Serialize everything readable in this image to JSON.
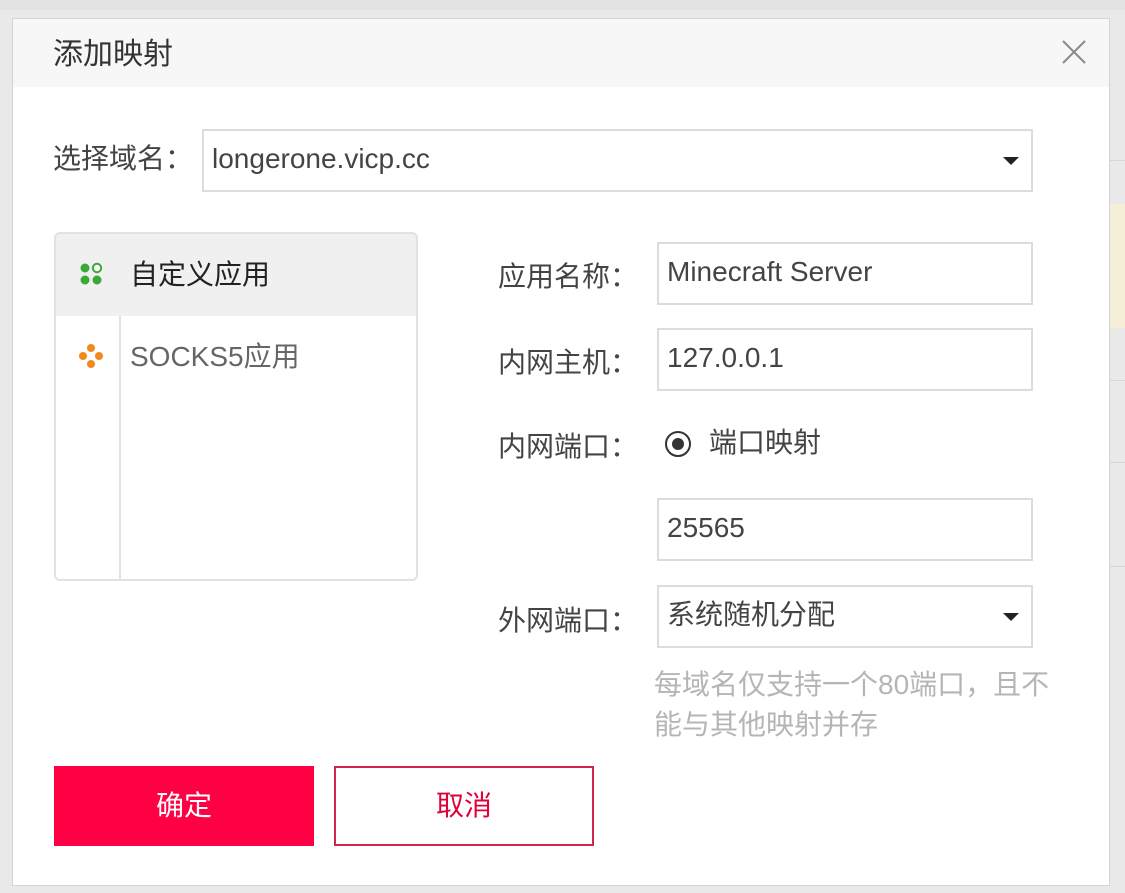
{
  "dialog": {
    "title": "添加映射",
    "close_icon": "close-icon"
  },
  "domain_select": {
    "label": "选择域名：",
    "value": "longerone.vicp.cc"
  },
  "apps": [
    {
      "label": "自定义应用",
      "icon": "custom-app-icon",
      "active": true
    },
    {
      "label": "SOCKS5应用",
      "icon": "socks5-app-icon",
      "active": false
    }
  ],
  "form": {
    "app_name": {
      "label": "应用名称：",
      "value": "Minecraft Server"
    },
    "internal_host": {
      "label": "内网主机：",
      "value": "127.0.0.1"
    },
    "internal_port": {
      "label": "内网端口：",
      "option_label": "端口映射",
      "value": "25565"
    },
    "external_port": {
      "label": "外网端口：",
      "value": "系统随机分配"
    }
  },
  "hint": "每域名仅支持一个80端口，且不能与其他映射并存",
  "buttons": {
    "confirm": "确定",
    "cancel": "取消"
  },
  "colors": {
    "primary": "#ff0045",
    "custom_icon_green": "#3aa935",
    "socks_icon_orange": "#f08a1c"
  }
}
